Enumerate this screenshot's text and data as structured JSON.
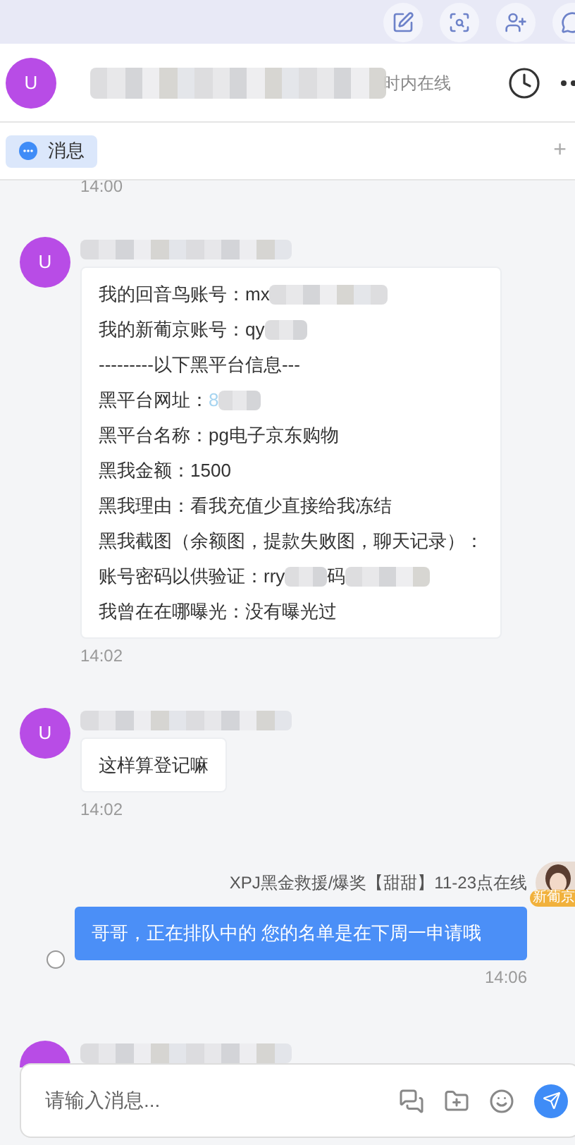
{
  "header": {
    "avatar": "U",
    "status": "时内在线"
  },
  "tabs": [
    {
      "label": "消息",
      "selected": true
    }
  ],
  "add_tab": "+",
  "first_time": "14:00",
  "messages": [
    {
      "kind": "incoming",
      "avatar": "U",
      "lines": [
        {
          "text": "我的回音鸟账号：mx",
          "redacted": true
        },
        {
          "text": "我的新葡京账号：qy",
          "redacted": true
        },
        {
          "text": "---------以下黑平台信息---"
        },
        {
          "text": "黑平台网址：",
          "link": "8",
          "redacted": true
        },
        {
          "text": "黑平台名称：pg电子京东购物"
        },
        {
          "text": "黑我金额：1500"
        },
        {
          "text": "黑我理由：看我充值少直接给我冻结"
        },
        {
          "text": "黑我截图（余额图，提款失败图，聊天记录）："
        },
        {
          "text": "账号密码以供验证：rry",
          "redacted": true,
          "tail": "码",
          "tail_redacted": true
        },
        {
          "text": "我曾在在哪曝光：没有曝光过"
        }
      ],
      "time": "14:02"
    },
    {
      "kind": "incoming",
      "avatar": "U",
      "lines": [
        {
          "text": "这样算登记嘛"
        }
      ],
      "time": "14:02"
    },
    {
      "kind": "outgoing",
      "sender": "XPJ黑金救援/爆奖【甜甜】11-23点在线",
      "badge": "新葡京",
      "text": "哥哥，正在排队中的 您的名单是在下周一申请哦",
      "selected": false,
      "time": "14:06"
    },
    {
      "kind": "partial"
    }
  ],
  "input": {
    "placeholder": "请输入消息..."
  }
}
